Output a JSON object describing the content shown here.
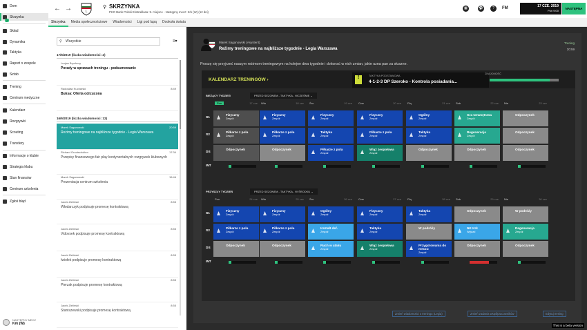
{
  "nav": {
    "items": [
      {
        "label": "Dom",
        "icon": "home-icon"
      },
      {
        "label": "Skrzynka",
        "icon": "inbox-icon",
        "active": true,
        "badge": "2"
      },
      {
        "label": "Skład",
        "icon": "squad-icon"
      },
      {
        "label": "Dynamika",
        "icon": "dynamics-icon"
      },
      {
        "label": "Taktyka",
        "icon": "tactics-icon"
      },
      {
        "label": "Raport o zespole",
        "icon": "report-icon"
      },
      {
        "label": "Sztab",
        "icon": "staff-icon"
      },
      {
        "label": "Trening",
        "icon": "training-icon"
      },
      {
        "label": "Centrum medyczne",
        "icon": "medical-icon"
      },
      {
        "label": "Kalendarz",
        "icon": "calendar-icon"
      },
      {
        "label": "Rozgrywki",
        "icon": "trophy-icon"
      },
      {
        "label": "Scouting",
        "icon": "scouting-icon"
      },
      {
        "label": "Transfery",
        "icon": "transfers-icon"
      },
      {
        "label": "Informacje o klubie",
        "icon": "club-info-icon"
      },
      {
        "label": "Strategia klubu",
        "icon": "strategy-icon"
      },
      {
        "label": "Stan finansów",
        "icon": "finances-icon"
      },
      {
        "label": "Centrum szkolenia",
        "icon": "academy-icon"
      },
      {
        "label": "Zgłoś błąd",
        "icon": "bug-icon"
      }
    ],
    "next_match_label": "NASTĘPNY MECZ",
    "next_match_value": "Krk (W)"
  },
  "topbar": {
    "title": "SKRZYNKA",
    "subtitle": "PKO Bank Polski Ekstraklasa: 9. miejsce - Następny mecz: Krk (W) (12 dni)",
    "fm": "FM",
    "date": "17 CZE. 2019",
    "day": "Pon 9:00",
    "next_btn": "NASTĘPNA"
  },
  "tabs": [
    "Skrzynka",
    "Media społecznościowe",
    "Wiadomości",
    "Ligi pod lupą",
    "Dookoła świata"
  ],
  "inbox": {
    "search_placeholder": "Wszystkie",
    "group1": "17/6/2019 (liczba wiadomości: 2)",
    "group2": "16/6/2019 (liczba wiadomości: 12)",
    "messages": [
      {
        "from": "Lucjan Brychczy",
        "time": "",
        "subject": "Porady w sprawach treningu - podsumowanie",
        "state": "unread"
      },
      {
        "from": "Radosław Kucharski",
        "time": "8:49",
        "subject": "Buksa: Oferta odrzucona",
        "state": "unread"
      },
      {
        "from": "Marek Saganowski",
        "time": "20:59",
        "subject": "Reżimy treningowe na najbliższe tygodnie - Legia Warszawa",
        "state": "sel"
      },
      {
        "from": "Richard Grootscholten",
        "time": "17:34",
        "subject": "Przepisy finansowego fair play kontynentalnych rozgrywek klubowych",
        "state": "read"
      },
      {
        "from": "Marek Saganowski",
        "time": "15:46",
        "subject": "Prezentacja centrum szkolenia",
        "state": "read"
      },
      {
        "from": "Jacek Zieliński",
        "time": "8:55",
        "subject": "Włodarczyk podpisuje promesę kontraktową",
        "state": "read"
      },
      {
        "from": "Jacek Zieliński",
        "time": "8:55",
        "subject": "Vidovsek podpisuje promesę kontraktową",
        "state": "read"
      },
      {
        "from": "Jacek Zieliński",
        "time": "8:55",
        "subject": "Iwiołek podpisuje promesę kontraktową",
        "state": "read"
      },
      {
        "from": "Jacek Zieliński",
        "time": "8:55",
        "subject": "Pierzak podpisuje promesę kontraktową",
        "state": "read"
      },
      {
        "from": "Jacek Zieliński",
        "time": "8:55",
        "subject": "Staniszewski podpisuje promesę kontraktową",
        "state": "read"
      }
    ]
  },
  "message": {
    "sender": "Marek Saganowski (Asystent)",
    "title": "Reżimy treningowe na najbliższe tygodnie - Legia Warszawa",
    "tag": "Trening",
    "time": "20:59",
    "body": "Proszę się przyjrzeć naszym reżimom treningowym na kolejne dwa tygodnie i dokonać w nich zmian, jakie uzna pan za słuszne."
  },
  "calendar": {
    "title": "KALENDARZ TRENINGÓW",
    "tactic_label": "TAKTYKA PODSTAWOWA",
    "tactic_value": "4-1-2-3 DP Szeroko - Kontrola posiadania...",
    "familiarity_label": "ZNAJOMOŚĆ",
    "familiarity": 0.87,
    "rows": [
      "S1",
      "S2",
      "DS",
      "INT"
    ],
    "weeks": [
      {
        "label": "BIEŻĄCY TYDZIEŃ",
        "schedule": "PRZED SEZONEM - TAKTYKA - WCZEŚNIE",
        "days": [
          {
            "n": "Pon",
            "d": "17 cze",
            "today": true
          },
          {
            "n": "Wto",
            "d": "18 cze"
          },
          {
            "n": "Śro",
            "d": "19 cze"
          },
          {
            "n": "Czw",
            "d": "20 cze"
          },
          {
            "n": "Pią",
            "d": "21 cze"
          },
          {
            "n": "Sob",
            "d": "22 cze"
          },
          {
            "n": "Nie",
            "d": "23 cze"
          }
        ],
        "cells": [
          [
            {
              "t": "Fizyczny",
              "s": "Zespół",
              "c": "c-dgrey"
            },
            {
              "t": "Fizyczny",
              "s": "Zespół",
              "c": "c-blue"
            },
            {
              "t": "Fizyczny",
              "s": "Zespół",
              "c": "c-blue"
            },
            {
              "t": "Fizyczny",
              "s": "Zespół",
              "c": "c-blue"
            },
            {
              "t": "Ogólny",
              "s": "Zespół",
              "c": "c-blue"
            },
            {
              "t": "Gra wewnętrzna",
              "s": "Zespół",
              "c": "c-teal"
            },
            {
              "t": "Odpoczynek",
              "s": "",
              "c": "c-grey rest"
            }
          ],
          [
            {
              "t": "Piłkarze z pola",
              "s": "Zespół",
              "c": "c-dgrey"
            },
            {
              "t": "Piłkarze z pola",
              "s": "Zespół",
              "c": "c-blue"
            },
            {
              "t": "Taktyka",
              "s": "Zespół",
              "c": "c-blue"
            },
            {
              "t": "Piłkarze z pola",
              "s": "Zespół",
              "c": "c-blue"
            },
            {
              "t": "Taktyka",
              "s": "Zespół",
              "c": "c-blue"
            },
            {
              "t": "Regeneracja",
              "s": "Zespół",
              "c": "c-teal"
            },
            {
              "t": "Odpoczynek",
              "s": "",
              "c": "c-grey rest"
            }
          ],
          [
            {
              "t": "Odpoczynek",
              "s": "",
              "c": "c-lgrey rest"
            },
            {
              "t": "Odpoczynek",
              "s": "",
              "c": "c-grey rest"
            },
            {
              "t": "Piłkarze z pola",
              "s": "Zespół",
              "c": "c-blue"
            },
            {
              "t": "Wiąż zespołowa",
              "s": "Zespół",
              "c": "c-green"
            },
            {
              "t": "Odpoczynek",
              "s": "",
              "c": "c-grey rest"
            },
            {
              "t": "Odpoczynek",
              "s": "",
              "c": "c-grey rest"
            },
            {
              "t": "Odpoczynek",
              "s": "",
              "c": "c-grey rest"
            }
          ]
        ],
        "intensity": [
          0.1,
          0.1,
          0.1,
          0.1,
          0.1,
          0.1,
          0.1
        ]
      },
      {
        "label": "PRZYSZŁY TYDZIEŃ",
        "schedule": "PRZED SEZONEM - TAKTYKA - W ŚRODKU",
        "days": [
          {
            "n": "Pon",
            "d": "24 cze"
          },
          {
            "n": "Wto",
            "d": "25 cze"
          },
          {
            "n": "Śro",
            "d": "26 cze"
          },
          {
            "n": "Czw",
            "d": "27 cze"
          },
          {
            "n": "Pią",
            "d": "28 cze"
          },
          {
            "n": "Sob",
            "d": "29 cze"
          },
          {
            "n": "Nie",
            "d": "30 cze"
          }
        ],
        "cells": [
          [
            {
              "t": "Fizyczny",
              "s": "Zespół",
              "c": "c-blue"
            },
            {
              "t": "Fizyczny",
              "s": "Zespół",
              "c": "c-blue"
            },
            {
              "t": "Ogólny",
              "s": "Zespół",
              "c": "c-blue"
            },
            {
              "t": "Fizyczny",
              "s": "Zespół",
              "c": "c-blue"
            },
            {
              "t": "Taktyka",
              "s": "Zespół",
              "c": "c-blue"
            },
            {
              "t": "Odpoczynek",
              "s": "",
              "c": "c-grey rest"
            },
            {
              "t": "W podróży",
              "s": "",
              "c": "c-grey rest"
            }
          ],
          [
            {
              "t": "Piłkarze z pola",
              "s": "Zespół",
              "c": "c-blue"
            },
            {
              "t": "Piłkarze z pola",
              "s": "Zespół",
              "c": "c-blue"
            },
            {
              "t": "Kształt def.",
              "s": "Zespół",
              "c": "c-sky"
            },
            {
              "t": "Taktyka",
              "s": "Zespół",
              "c": "c-blue"
            },
            {
              "t": "W podróży",
              "s": "",
              "c": "c-grey rest"
            },
            {
              "t": "NK Krk",
              "s": "Wyjazd",
              "c": "c-sky"
            },
            {
              "t": "Regeneracja",
              "s": "Zespół",
              "c": "c-teal"
            }
          ],
          [
            {
              "t": "Odpoczynek",
              "s": "",
              "c": "c-grey rest"
            },
            {
              "t": "Odpoczynek",
              "s": "",
              "c": "c-grey rest"
            },
            {
              "t": "Ruch w ataku",
              "s": "Zespół",
              "c": "c-sky"
            },
            {
              "t": "Wiąż zespołowa",
              "s": "Zespół",
              "c": "c-green"
            },
            {
              "t": "Przygotowania do meczu",
              "s": "Zespół",
              "c": "c-blue"
            },
            {
              "t": "Odpoczynek",
              "s": "",
              "c": "c-grey rest"
            },
            {
              "t": "Odpoczynek",
              "s": "",
              "c": "c-grey rest"
            }
          ]
        ],
        "intensity": [
          0.1,
          0.1,
          0.1,
          0.1,
          0.1,
          0.5,
          0.1
        ]
      }
    ]
  },
  "buttons": [
    "Zmień wiadomości o treningu (Legia)",
    "Zmień zadania współpracowników",
    "Edytuj trening"
  ],
  "beta": "This is a beta version"
}
